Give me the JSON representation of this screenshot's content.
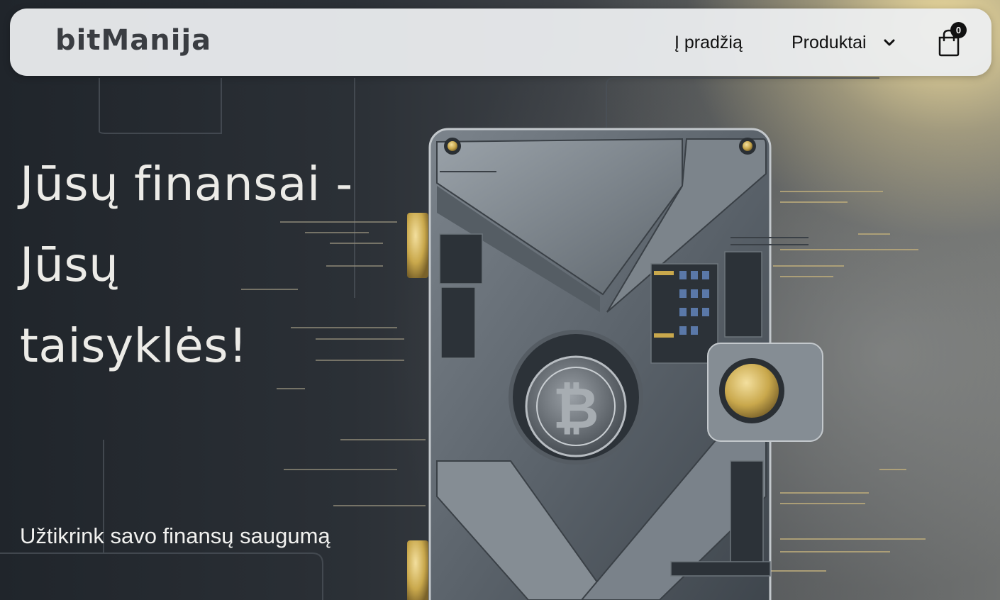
{
  "brand": {
    "name": "bitManija"
  },
  "nav": {
    "home_label": "Į pradžią",
    "products_label": "Produktai",
    "cart_count": "0"
  },
  "hero": {
    "title": "Jūsų finansai - Jūsų taisyklės!",
    "subtitle": "Užtikrink savo finansų saugumą"
  },
  "colors": {
    "header_bg": "#eceef0",
    "text_dark": "#111111",
    "hero_text": "#ecebe7",
    "gold_accent": "#c9a84c"
  },
  "icons": {
    "dropdown": "chevron-down-icon",
    "cart": "shopping-bag-icon"
  }
}
